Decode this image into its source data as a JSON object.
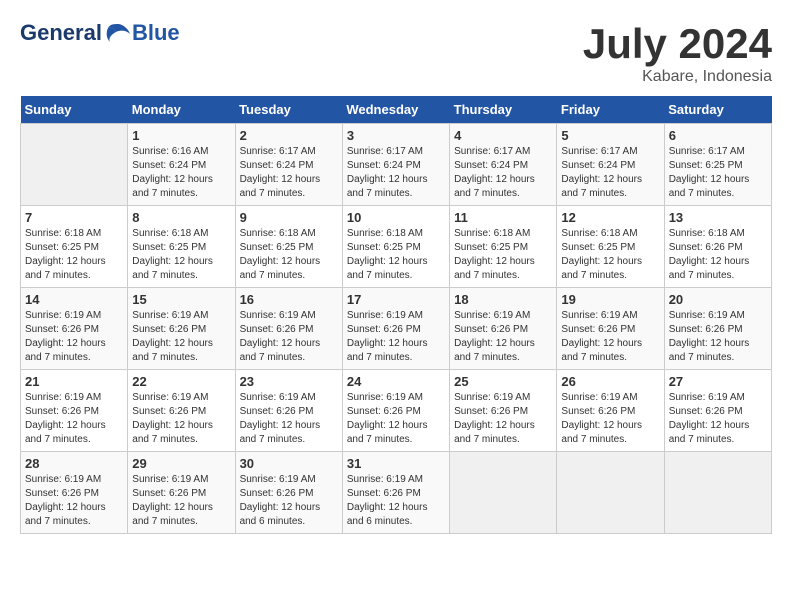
{
  "header": {
    "logo_line1": "General",
    "logo_line2": "Blue",
    "month": "July 2024",
    "location": "Kabare, Indonesia"
  },
  "weekdays": [
    "Sunday",
    "Monday",
    "Tuesday",
    "Wednesday",
    "Thursday",
    "Friday",
    "Saturday"
  ],
  "weeks": [
    [
      {
        "day": "",
        "info": ""
      },
      {
        "day": "1",
        "info": "Sunrise: 6:16 AM\nSunset: 6:24 PM\nDaylight: 12 hours\nand 7 minutes."
      },
      {
        "day": "2",
        "info": "Sunrise: 6:17 AM\nSunset: 6:24 PM\nDaylight: 12 hours\nand 7 minutes."
      },
      {
        "day": "3",
        "info": "Sunrise: 6:17 AM\nSunset: 6:24 PM\nDaylight: 12 hours\nand 7 minutes."
      },
      {
        "day": "4",
        "info": "Sunrise: 6:17 AM\nSunset: 6:24 PM\nDaylight: 12 hours\nand 7 minutes."
      },
      {
        "day": "5",
        "info": "Sunrise: 6:17 AM\nSunset: 6:24 PM\nDaylight: 12 hours\nand 7 minutes."
      },
      {
        "day": "6",
        "info": "Sunrise: 6:17 AM\nSunset: 6:25 PM\nDaylight: 12 hours\nand 7 minutes."
      }
    ],
    [
      {
        "day": "7",
        "info": "Sunrise: 6:18 AM\nSunset: 6:25 PM\nDaylight: 12 hours\nand 7 minutes."
      },
      {
        "day": "8",
        "info": "Sunrise: 6:18 AM\nSunset: 6:25 PM\nDaylight: 12 hours\nand 7 minutes."
      },
      {
        "day": "9",
        "info": "Sunrise: 6:18 AM\nSunset: 6:25 PM\nDaylight: 12 hours\nand 7 minutes."
      },
      {
        "day": "10",
        "info": "Sunrise: 6:18 AM\nSunset: 6:25 PM\nDaylight: 12 hours\nand 7 minutes."
      },
      {
        "day": "11",
        "info": "Sunrise: 6:18 AM\nSunset: 6:25 PM\nDaylight: 12 hours\nand 7 minutes."
      },
      {
        "day": "12",
        "info": "Sunrise: 6:18 AM\nSunset: 6:25 PM\nDaylight: 12 hours\nand 7 minutes."
      },
      {
        "day": "13",
        "info": "Sunrise: 6:18 AM\nSunset: 6:26 PM\nDaylight: 12 hours\nand 7 minutes."
      }
    ],
    [
      {
        "day": "14",
        "info": "Sunrise: 6:19 AM\nSunset: 6:26 PM\nDaylight: 12 hours\nand 7 minutes."
      },
      {
        "day": "15",
        "info": "Sunrise: 6:19 AM\nSunset: 6:26 PM\nDaylight: 12 hours\nand 7 minutes."
      },
      {
        "day": "16",
        "info": "Sunrise: 6:19 AM\nSunset: 6:26 PM\nDaylight: 12 hours\nand 7 minutes."
      },
      {
        "day": "17",
        "info": "Sunrise: 6:19 AM\nSunset: 6:26 PM\nDaylight: 12 hours\nand 7 minutes."
      },
      {
        "day": "18",
        "info": "Sunrise: 6:19 AM\nSunset: 6:26 PM\nDaylight: 12 hours\nand 7 minutes."
      },
      {
        "day": "19",
        "info": "Sunrise: 6:19 AM\nSunset: 6:26 PM\nDaylight: 12 hours\nand 7 minutes."
      },
      {
        "day": "20",
        "info": "Sunrise: 6:19 AM\nSunset: 6:26 PM\nDaylight: 12 hours\nand 7 minutes."
      }
    ],
    [
      {
        "day": "21",
        "info": "Sunrise: 6:19 AM\nSunset: 6:26 PM\nDaylight: 12 hours\nand 7 minutes."
      },
      {
        "day": "22",
        "info": "Sunrise: 6:19 AM\nSunset: 6:26 PM\nDaylight: 12 hours\nand 7 minutes."
      },
      {
        "day": "23",
        "info": "Sunrise: 6:19 AM\nSunset: 6:26 PM\nDaylight: 12 hours\nand 7 minutes."
      },
      {
        "day": "24",
        "info": "Sunrise: 6:19 AM\nSunset: 6:26 PM\nDaylight: 12 hours\nand 7 minutes."
      },
      {
        "day": "25",
        "info": "Sunrise: 6:19 AM\nSunset: 6:26 PM\nDaylight: 12 hours\nand 7 minutes."
      },
      {
        "day": "26",
        "info": "Sunrise: 6:19 AM\nSunset: 6:26 PM\nDaylight: 12 hours\nand 7 minutes."
      },
      {
        "day": "27",
        "info": "Sunrise: 6:19 AM\nSunset: 6:26 PM\nDaylight: 12 hours\nand 7 minutes."
      }
    ],
    [
      {
        "day": "28",
        "info": "Sunrise: 6:19 AM\nSunset: 6:26 PM\nDaylight: 12 hours\nand 7 minutes."
      },
      {
        "day": "29",
        "info": "Sunrise: 6:19 AM\nSunset: 6:26 PM\nDaylight: 12 hours\nand 7 minutes."
      },
      {
        "day": "30",
        "info": "Sunrise: 6:19 AM\nSunset: 6:26 PM\nDaylight: 12 hours\nand 6 minutes."
      },
      {
        "day": "31",
        "info": "Sunrise: 6:19 AM\nSunset: 6:26 PM\nDaylight: 12 hours\nand 6 minutes."
      },
      {
        "day": "",
        "info": ""
      },
      {
        "day": "",
        "info": ""
      },
      {
        "day": "",
        "info": ""
      }
    ]
  ]
}
